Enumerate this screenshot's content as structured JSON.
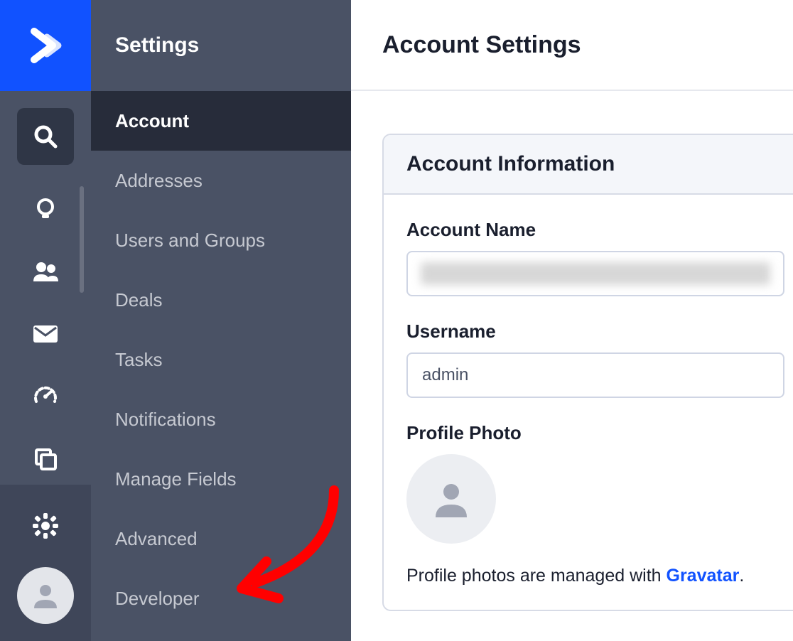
{
  "sidebar": {
    "title": "Settings",
    "items": [
      {
        "label": "Account",
        "active": true
      },
      {
        "label": "Addresses"
      },
      {
        "label": "Users and Groups"
      },
      {
        "label": "Deals"
      },
      {
        "label": "Tasks"
      },
      {
        "label": "Notifications"
      },
      {
        "label": "Manage Fields"
      },
      {
        "label": "Advanced"
      },
      {
        "label": "Developer"
      }
    ]
  },
  "main": {
    "title": "Account Settings",
    "card_title": "Account Information",
    "fields": {
      "account_name_label": "Account Name",
      "account_name_value": "",
      "username_label": "Username",
      "username_value": "admin",
      "profile_photo_label": "Profile Photo",
      "help_text_prefix": "Profile photos are managed with ",
      "help_link_text": "Gravatar",
      "help_text_suffix": "."
    }
  },
  "rail": {
    "icons": [
      "search-icon",
      "lightbulb-icon",
      "people-icon",
      "envelope-icon",
      "gauge-icon",
      "copy-icon",
      "gear-icon"
    ]
  }
}
